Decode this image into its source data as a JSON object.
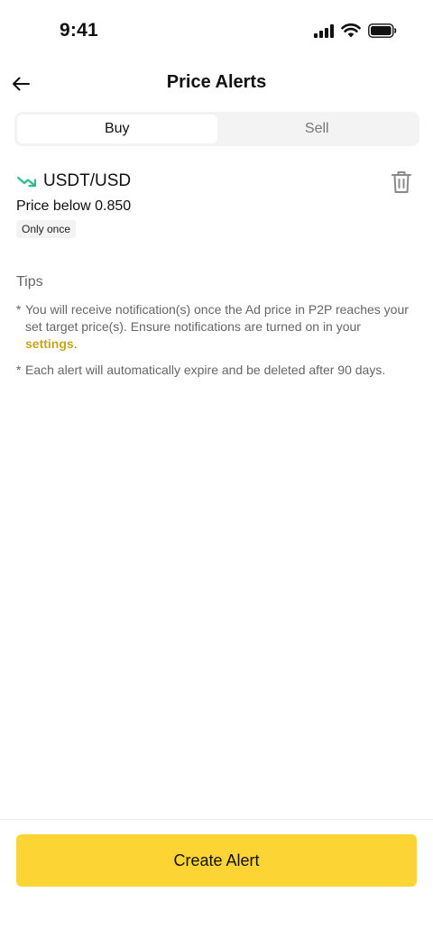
{
  "status_bar": {
    "time": "9:41"
  },
  "header": {
    "title": "Price Alerts"
  },
  "tabs": [
    {
      "label": "Buy",
      "active": true
    },
    {
      "label": "Sell",
      "active": false
    }
  ],
  "alert": {
    "pair": "USDT/USD",
    "condition": "Price below 0.850",
    "frequency": "Only once",
    "trend_color": "#2ebd85"
  },
  "tips": {
    "title": "Tips",
    "bullet": "*",
    "tip1_text": "You will receive notification(s) once the Ad price in P2P reaches your set target price(s). Ensure notifications are turned on in your ",
    "tip1_link": "settings",
    "tip1_end": ".",
    "tip2_text": "Each alert will automatically expire and be deleted after 90 days."
  },
  "footer": {
    "create_label": "Create Alert",
    "accent": "#fcd535"
  },
  "colors": {
    "link": "#c9a51b"
  }
}
